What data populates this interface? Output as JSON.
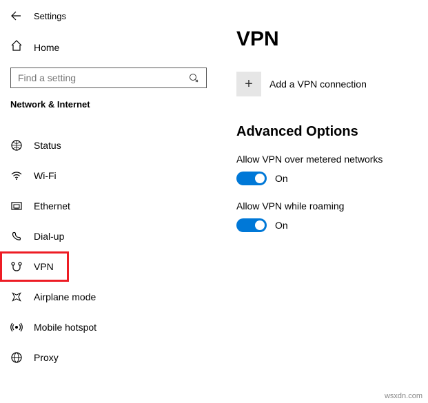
{
  "titlebar": {
    "title": "Settings"
  },
  "home": {
    "label": "Home"
  },
  "search": {
    "placeholder": "Find a setting"
  },
  "section": {
    "header": "Network & Internet"
  },
  "nav": {
    "items": [
      {
        "label": "Status"
      },
      {
        "label": "Wi-Fi"
      },
      {
        "label": "Ethernet"
      },
      {
        "label": "Dial-up"
      },
      {
        "label": "VPN"
      },
      {
        "label": "Airplane mode"
      },
      {
        "label": "Mobile hotspot"
      },
      {
        "label": "Proxy"
      }
    ]
  },
  "page": {
    "title": "VPN",
    "add_label": "Add a VPN connection",
    "plus": "+",
    "advanced_title": "Advanced Options",
    "opt_metered": {
      "label": "Allow VPN over metered networks",
      "state_text": "On"
    },
    "opt_roaming": {
      "label": "Allow VPN while roaming",
      "state_text": "On"
    }
  },
  "watermark": "wsxdn.com"
}
